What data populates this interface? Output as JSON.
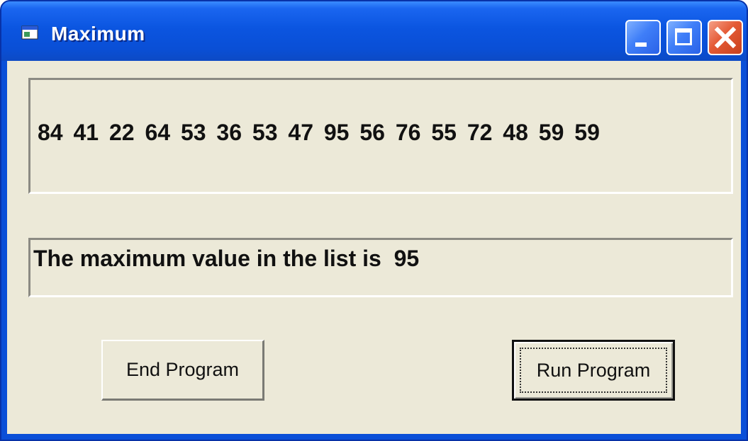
{
  "window": {
    "title": "Maximum",
    "icon": "app-window-icon",
    "controls": {
      "minimize_icon": "minimize-icon",
      "maximize_icon": "maximize-icon",
      "close_icon": "close-icon"
    }
  },
  "list_display": {
    "text": "84  41  22  64  53  36  53  47  95  56  76  55  72  48  59  59"
  },
  "result_display": {
    "text": "The maximum value in the list is  95"
  },
  "buttons": {
    "end_label": "End Program",
    "run_label": "Run Program"
  },
  "colors": {
    "titlebar": "#0a4fd8",
    "client_bg": "#ece9d8",
    "close_button": "#e45a35"
  }
}
